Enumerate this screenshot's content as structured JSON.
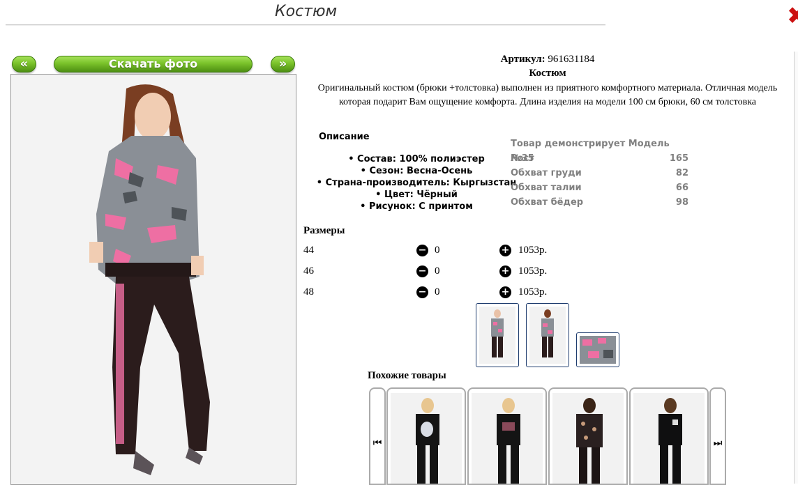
{
  "header": {
    "title": "Костюм",
    "close_icon": "close-x-icon"
  },
  "photo_nav": {
    "prev_label": "«",
    "download_label": "Скачать фото",
    "next_label": "»"
  },
  "product": {
    "articul_label": "Артикул:",
    "articul_value": "961631184",
    "name": "Костюм",
    "description": "Оригинальный костюм (брюки +толстовка) выполнен из приятного комфортного материала. Отличная модель которая подарит Вам ощущение комфорта. Длина изделия на модели 100 см брюки, 60 см толстовка"
  },
  "properties": {
    "title": "Описание",
    "items": [
      "Состав: 100% полиэстер",
      "Сезон: Весна-Осень",
      "Страна-производитель: Кыргызстан",
      "Цвет: Чёрный",
      "Рисунок: С принтом"
    ]
  },
  "model": {
    "title": "Товар демонстрирует Модель №35",
    "rows": [
      {
        "label": "Рост",
        "value": "165"
      },
      {
        "label": "Обхват груди",
        "value": "82"
      },
      {
        "label": "Обхват талии",
        "value": "66"
      },
      {
        "label": "Обхват бёдер",
        "value": "98"
      }
    ]
  },
  "sizes": {
    "title": "Размеры",
    "minus_icon": "minus-circle-icon",
    "plus_icon": "plus-circle-icon",
    "rows": [
      {
        "size": "44",
        "qty": "0",
        "price": "1053р."
      },
      {
        "size": "46",
        "qty": "0",
        "price": "1053р."
      },
      {
        "size": "48",
        "qty": "0",
        "price": "1053р."
      }
    ]
  },
  "similar": {
    "title": "Похожие товары",
    "prev_icon": "carousel-prev-icon",
    "next_icon": "carousel-next-icon",
    "prev_glyph": "⏮",
    "next_glyph": "⏭"
  },
  "colors": {
    "camo_pink": "#ee6fa3",
    "camo_grey": "#8a8f96",
    "pants": "#2b1c1c",
    "button_green": "#7ac22a",
    "close_red": "#cc1111"
  }
}
